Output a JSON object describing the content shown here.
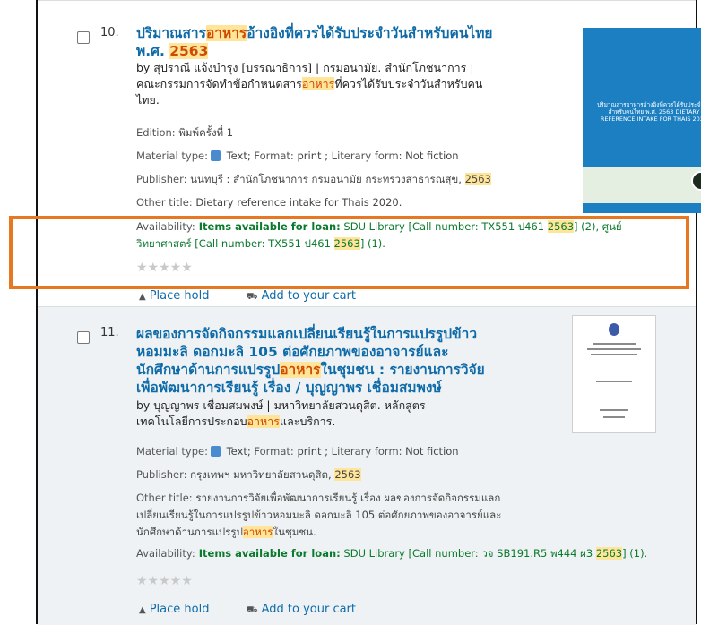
{
  "results": [
    {
      "number": "10.",
      "title_pre": "ปริมาณสาร",
      "title_hl": "อาหาร",
      "title_post": "อ้างอิงที่ควรได้รับประจำวันสำหรับคนไทย",
      "title_line2_pre": "พ.ศ. ",
      "title_line2_hl": "2563",
      "by_line1": "by สุปราณี แจ้งบำรุง [บรรณาธิการ] | กรมอนามัย. สำนักโภชนาการ |",
      "by_line2_pre": "คณะกรรมการจัดทำข้อกำหนดสาร",
      "by_line2_hl": "อาหาร",
      "by_line2_post": "ที่ควรได้รับประจำวันสำหรับคน",
      "by_line3": "ไทย.",
      "edition_label": "Edition:",
      "edition_value": " พิมพ์ครั้งที่ 1",
      "material_label": "Material type:",
      "material_value": " Text;",
      "format_label": " Format:",
      "format_value": " print ;",
      "literary_label": " Literary form:",
      "literary_value": " Not fiction",
      "publisher_label": "Publisher:",
      "publisher_value": " นนทบุรี : สำนักโภชนาการ กรมอนามัย กระทรวงสาธารณสุข, ",
      "publisher_year": "2563",
      "other_label": "Other title:",
      "other_value": " Dietary reference intake for Thais 2020.",
      "avail_label": "Availability:",
      "avail_bold": " Items available for loan:",
      "avail_line1_pre": " SDU Library [Call number: TX551 ป461 ",
      "avail_line1_year": "2563",
      "avail_line1_post": "] (2), ศูนย์",
      "avail_line2_pre": "วิทยาศาสตร์ [Call number: TX551 ป461 ",
      "avail_line2_year": "2563",
      "avail_line2_post": "] (1).",
      "stars": "★★★★★",
      "place_hold": "Place hold",
      "add_cart": "Add to your cart",
      "cover_text": "ปริมาณสารอาหารอ้างอิงที่ควรได้รับประจำวัน สำหรับคนไทย พ.ศ. 2563 DIETARY REFERENCE INTAKE FOR THAIS 2020"
    },
    {
      "number": "11.",
      "title_l1": "ผลของการจัดกิจกรรมแลกเปลี่ยนเรียนรู้ในการแปรรูปข้าว",
      "title_l2": "หอมมะลิ ดอกมะลิ 105 ต่อศักยภาพของอาจารย์และ",
      "title_l3_pre": "นักศึกษาด้านการแปรรูป",
      "title_l3_hl": "อาหาร",
      "title_l3_post": "ในชุมชน : รายงานการวิจัย",
      "title_l4": "เพื่อพัฒนาการเรียนรู้ เรื่อง / บุญญาพร เชื่อมสมพงษ์",
      "by_line1": "by บุญญาพร เชื่อมสมพงษ์ | มหาวิทยาลัยสวนดุสิต. หลักสูตร",
      "by_line2_pre": "เทคโนโลยีการประกอบ",
      "by_line2_hl": "อาหาร",
      "by_line2_post": "และบริการ.",
      "material_label": "Material type:",
      "material_value": " Text;",
      "format_label": " Format:",
      "format_value": " print ;",
      "literary_label": " Literary form:",
      "literary_value": " Not fiction",
      "publisher_label": "Publisher:",
      "publisher_value": " กรุงเทพฯ มหาวิทยาลัยสวนดุสิต, ",
      "publisher_year": "2563",
      "other_label": "Other title:",
      "other_l1": " รายงานการวิจัยเพื่อพัฒนาการเรียนรู้ เรื่อง ผลของการจัดกิจกรรมแลก",
      "other_l2": "เปลี่ยนเรียนรู้ในการแปรรูปข้าวหอมมะลิ ดอกมะลิ 105 ต่อศักยภาพของอาจารย์และ",
      "other_l3_pre": "นักศึกษาด้านการแปรรูป",
      "other_l3_hl": "อาหาร",
      "other_l3_post": "ในชุมชน.",
      "avail_label": "Availability:",
      "avail_bold": " Items available for loan:",
      "avail_pre": " SDU Library [Call number: วจ SB191.R5 พ444 ผ3 ",
      "avail_year": "2563",
      "avail_post": "] (1).",
      "stars": "★★★★★",
      "place_hold": "Place hold",
      "add_cart": "Add to your cart"
    }
  ],
  "colors": {
    "link": "#0f6ba8",
    "highlight": "#ffe599",
    "available": "#0a7a2c",
    "annotation": "#e87722"
  }
}
